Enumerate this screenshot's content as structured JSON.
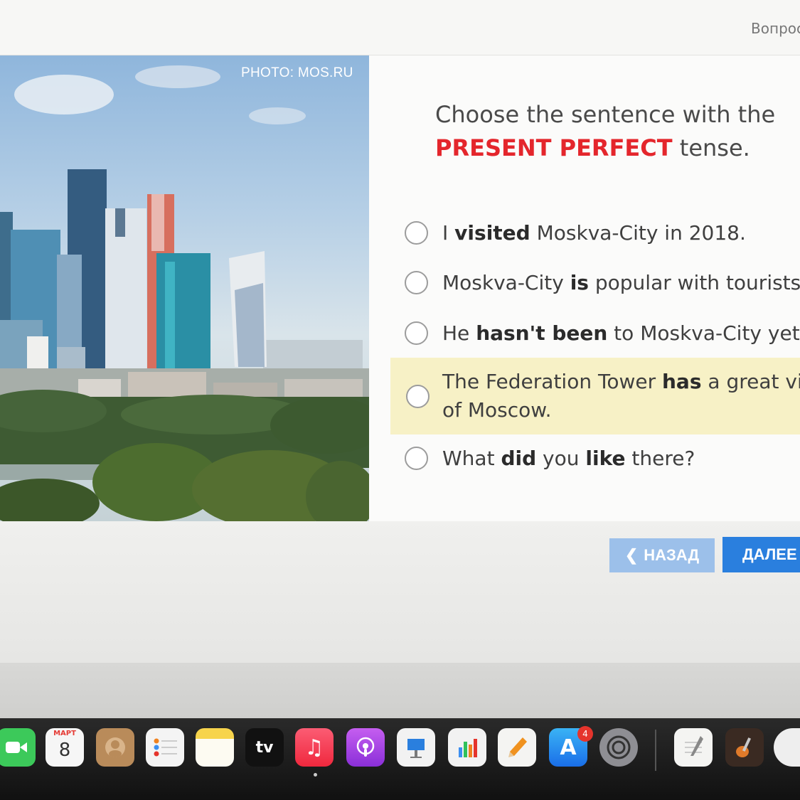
{
  "header": {
    "question_counter": "Вопрос"
  },
  "photo": {
    "credit": "PHOTO: MOS.RU"
  },
  "question": {
    "line1": "Choose the sentence with the",
    "highlight": "PRESENT PERFECT",
    "line2_rest": " tense."
  },
  "options": [
    {
      "pre": "I ",
      "bold": "visited",
      "post": " Moskva-City in 2018."
    },
    {
      "pre": "Moskva-City ",
      "bold": "is",
      "post": " popular with tourists."
    },
    {
      "pre": "He ",
      "bold": "hasn't been",
      "post": " to Moskva-City yet."
    },
    {
      "pre": "The Federation Tower ",
      "bold": "has",
      "post": " a great view",
      "line2": "of Moscow."
    },
    {
      "pre": "What ",
      "bold": "did",
      "mid": " you ",
      "bold2": "like",
      "post": " there?"
    }
  ],
  "nav": {
    "back_label": "НАЗАД",
    "next_label": "ДАЛЕЕ"
  },
  "dock": {
    "calendar_month": "МАРТ",
    "calendar_day": "8",
    "tv_label": "tv",
    "app_store_badge": "4",
    "icons": [
      "facetime-icon",
      "calendar-icon",
      "contacts-icon",
      "reminders-icon",
      "notes-icon",
      "apple-tv-icon",
      "music-icon",
      "podcasts-icon",
      "keynote-icon",
      "numbers-icon",
      "pages-icon",
      "app-store-icon",
      "system-preferences-icon",
      "textedit-icon",
      "garageband-icon",
      "utilities-icon"
    ]
  },
  "colors": {
    "accent_red": "#e4262c",
    "primary_button": "#2a7fde",
    "secondary_button": "#9cc0ea",
    "highlight_row": "#f7f1c6"
  }
}
